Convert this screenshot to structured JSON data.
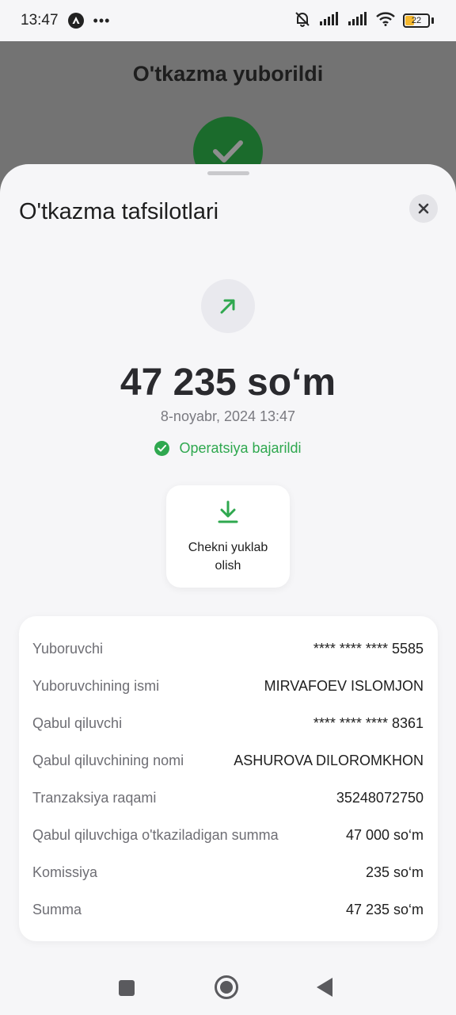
{
  "status_bar": {
    "time": "13:47",
    "dots": "•••",
    "battery_level": "22",
    "icons": [
      "app-icon",
      "bell-off-icon",
      "signal-icon",
      "signal-icon",
      "wifi-icon",
      "battery-icon"
    ]
  },
  "background_screen": {
    "title": "O'tkazma yuborildi"
  },
  "sheet": {
    "title": "O'tkazma tafsilotlari",
    "amount": "47 235 so‘m",
    "date": "8-noyabr, 2024 13:47",
    "status": "Operatsiya bajarildi",
    "download_label": "Chekni yuklab olish"
  },
  "details": [
    {
      "label": "Yuboruvchi",
      "value": "**** **** **** 5585"
    },
    {
      "label": "Yuboruvchining ismi",
      "value": "MIRVAFOEV ISLOMJON"
    },
    {
      "label": "Qabul qiluvchi",
      "value": "**** **** **** 8361"
    },
    {
      "label": "Qabul qiluvchining nomi",
      "value": "ASHUROVA DILOROMKHON"
    },
    {
      "label": "Tranzaksiya raqami",
      "value": "35248072750"
    },
    {
      "label": "Qabul qiluvchiga o'tkaziladigan summa",
      "value": "47 000 so‘m"
    },
    {
      "label": "Komissiya",
      "value": "235 so‘m"
    },
    {
      "label": "Summa",
      "value": "47 235 so‘m"
    }
  ],
  "colors": {
    "success": "#2fa84f",
    "battery": "#f5b82e",
    "overlay": "#737373"
  }
}
